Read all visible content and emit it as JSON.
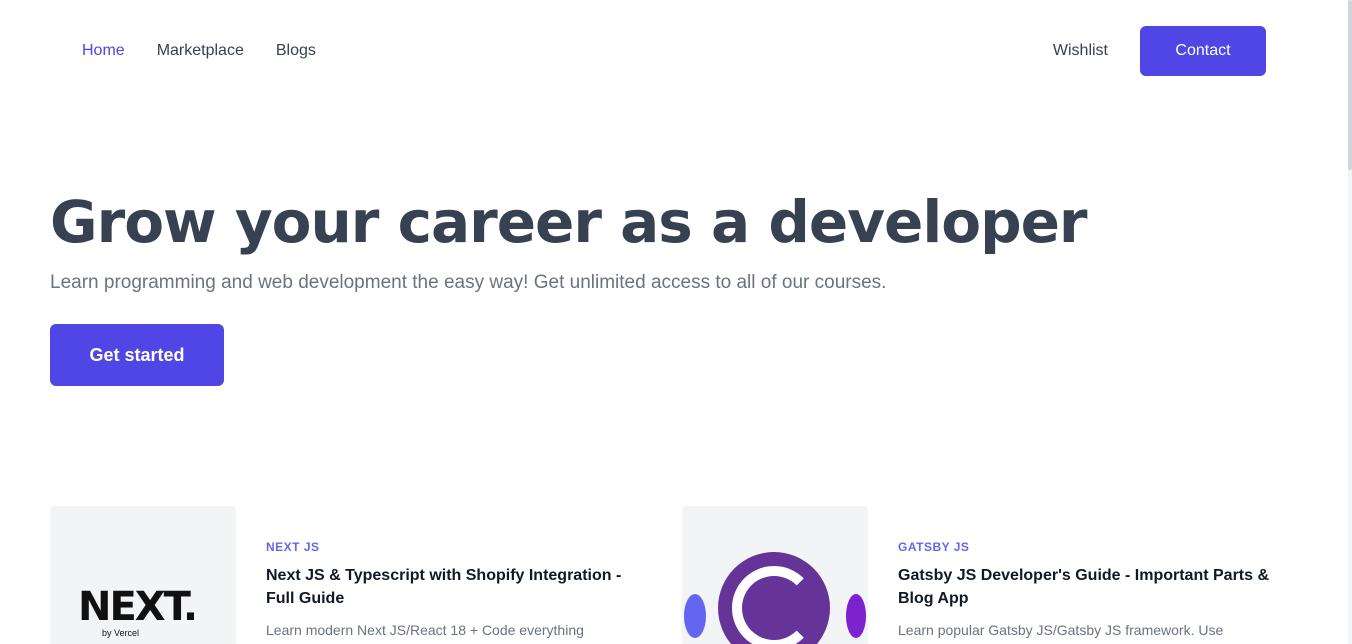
{
  "nav": {
    "links": [
      "Home",
      "Marketplace",
      "Blogs"
    ],
    "wishlist": "Wishlist",
    "contact": "Contact"
  },
  "hero": {
    "title": "Grow your career as a developer",
    "subtitle": "Learn programming and web development the easy way! Get unlimited access to all of our courses.",
    "cta": "Get started"
  },
  "courses": [
    {
      "tag": "NEXT JS",
      "title": "Next JS & Typescript with Shopify Integration - Full Guide",
      "description": "Learn modern Next JS/React 18 + Code everything",
      "thumb_logo": "NEXT.",
      "thumb_sub": "by Vercel"
    },
    {
      "tag": "GATSBY JS",
      "title": "Gatsby JS Developer's Guide - Important Parts & Blog App",
      "description": "Learn popular Gatsby JS/Gatsby JS framework. Use",
      "thumb_logo": "gatsby-logo"
    }
  ],
  "colors": {
    "accent": "#4f46e5",
    "tag": "#6366f1",
    "gatsby": "#663399"
  }
}
